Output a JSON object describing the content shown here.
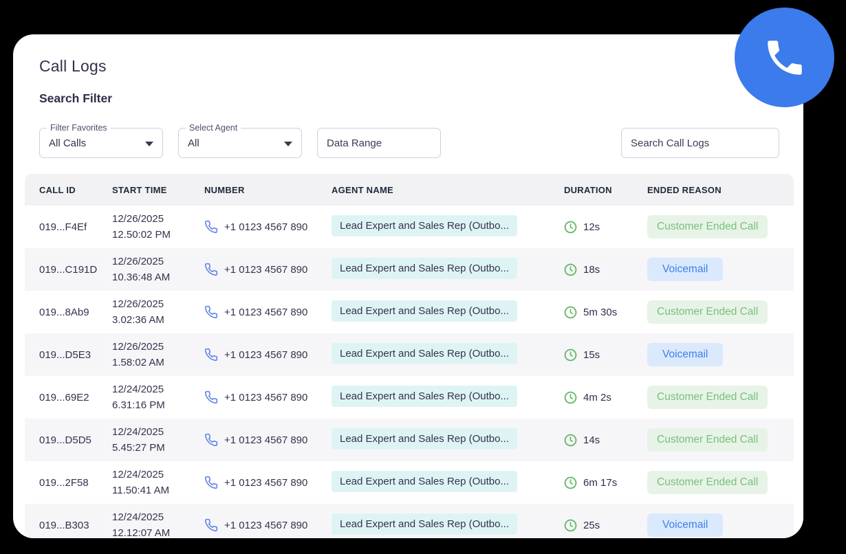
{
  "page": {
    "title": "Call Logs",
    "filter_heading": "Search Filter"
  },
  "colors": {
    "fab_blue": "#3b7beb",
    "agent_badge_bg": "#def4f4",
    "reason_green": "#76c17a",
    "reason_green_bg": "#e8f3e8",
    "reason_blue": "#3c7fe9",
    "reason_blue_bg": "#dbe9fc",
    "row_phone_icon": "#6485e8",
    "clock_icon_green": "#68b96c"
  },
  "filters": {
    "favorites": {
      "label": "Filter Favorites",
      "value": "All Calls"
    },
    "agent": {
      "label": "Select Agent",
      "value": "All"
    },
    "range": {
      "placeholder": "Data Range"
    },
    "search": {
      "placeholder": "Search Call Logs"
    }
  },
  "table": {
    "columns": [
      "CALL ID",
      "START TIME",
      "NUMBER",
      "AGENT NAME",
      "DURATION",
      "ENDED REASON"
    ],
    "rows": [
      {
        "id": "019...F4Ef",
        "date": "12/26/2025",
        "time": "12.50:02 PM",
        "number": "+1 0123 4567 890",
        "agent": "Lead Expert and Sales Rep (Outbo...",
        "duration": "12s",
        "reason": "Customer Ended Call",
        "variant": "green"
      },
      {
        "id": "019...C191D",
        "date": "12/26/2025",
        "time": "10.36:48 AM",
        "number": "+1 0123 4567 890",
        "agent": "Lead Expert and Sales Rep (Outbo...",
        "duration": "18s",
        "reason": "Voicemail",
        "variant": "blue"
      },
      {
        "id": "019...8Ab9",
        "date": "12/26/2025",
        "time": "3.02:36 AM",
        "number": "+1 0123 4567 890",
        "agent": "Lead Expert and Sales Rep (Outbo...",
        "duration": "5m 30s",
        "reason": "Customer Ended Call",
        "variant": "green"
      },
      {
        "id": "019...D5E3",
        "date": "12/26/2025",
        "time": "1.58:02 AM",
        "number": "+1 0123 4567 890",
        "agent": "Lead Expert and Sales Rep (Outbo...",
        "duration": "15s",
        "reason": "Voicemail",
        "variant": "blue"
      },
      {
        "id": "019...69E2",
        "date": "12/24/2025",
        "time": "6.31:16 PM",
        "number": "+1 0123 4567 890",
        "agent": "Lead Expert and Sales Rep (Outbo...",
        "duration": "4m 2s",
        "reason": "Customer Ended Call",
        "variant": "green"
      },
      {
        "id": "019...D5D5",
        "date": "12/24/2025",
        "time": "5.45:27 PM",
        "number": "+1 0123 4567 890",
        "agent": "Lead Expert and Sales Rep (Outbo...",
        "duration": "14s",
        "reason": "Customer Ended Call",
        "variant": "green"
      },
      {
        "id": "019...2F58",
        "date": "12/24/2025",
        "time": "11.50:41 AM",
        "number": "+1 0123 4567 890",
        "agent": "Lead Expert and Sales Rep (Outbo...",
        "duration": "6m 17s",
        "reason": "Customer Ended Call",
        "variant": "green"
      },
      {
        "id": "019...B303",
        "date": "12/24/2025",
        "time": "12.12:07 AM",
        "number": "+1 0123 4567 890",
        "agent": "Lead Expert and Sales Rep (Outbo...",
        "duration": "25s",
        "reason": "Voicemail",
        "variant": "blue"
      }
    ]
  }
}
